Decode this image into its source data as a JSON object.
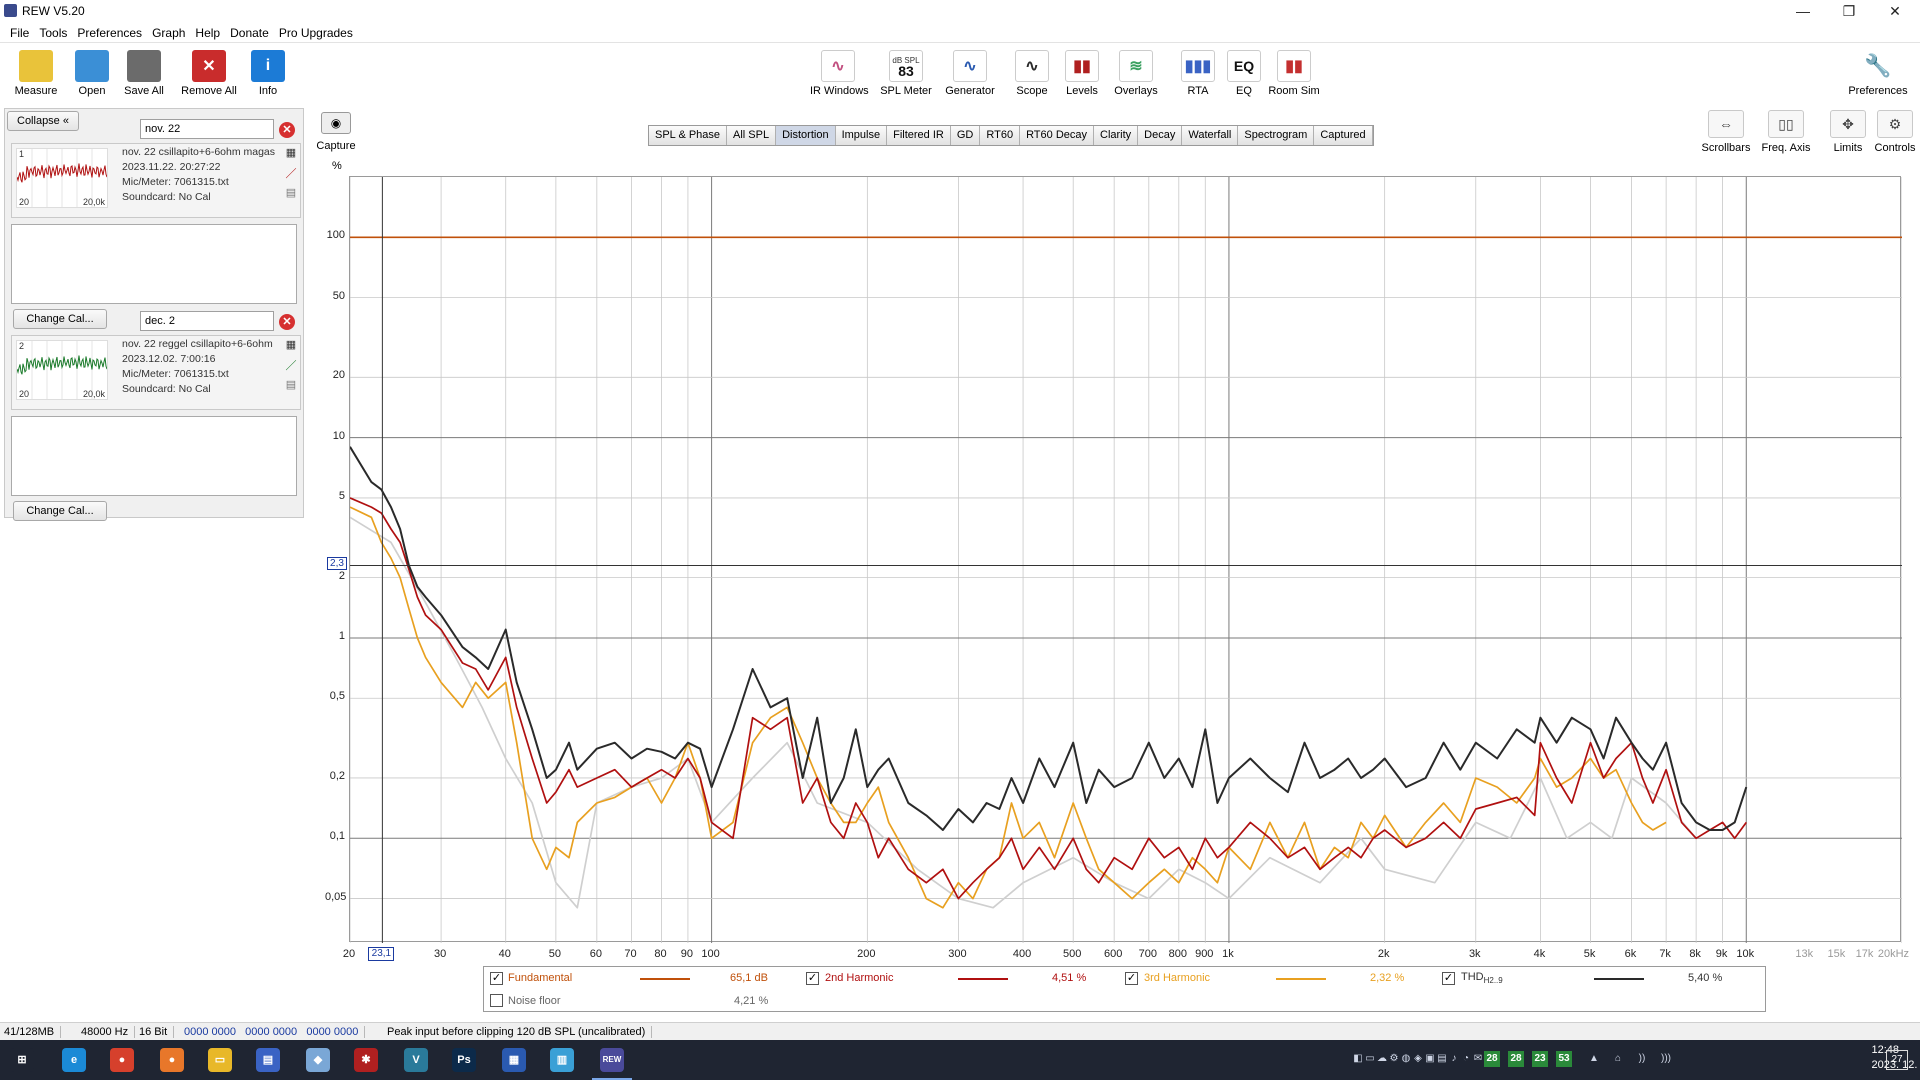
{
  "window": {
    "title": "REW V5.20",
    "minimize": "—",
    "maximize": "❐",
    "close": "✕"
  },
  "menu": [
    "File",
    "Tools",
    "Preferences",
    "Graph",
    "Help",
    "Donate",
    "Pro Upgrades"
  ],
  "toolbar_left": [
    {
      "label": "Measure",
      "icon": "measure-icon",
      "color": "#e9c33a"
    },
    {
      "label": "Open",
      "icon": "folder-open-icon",
      "color": "#3b8fd6"
    },
    {
      "label": "Save All",
      "icon": "save-icon",
      "color": "#6b6b6b"
    },
    {
      "label": "Remove All",
      "icon": "remove-icon",
      "color": "#c92c2c"
    },
    {
      "label": "Info",
      "icon": "info-icon",
      "color": "#1c7bd6"
    }
  ],
  "toolbar_center": [
    {
      "label": "IR Windows",
      "icon": "ir-windows-icon"
    },
    {
      "label": "SPL Meter",
      "icon": "spl-meter-icon",
      "badge_top": "dB SPL",
      "badge_value": "83"
    },
    {
      "label": "Generator",
      "icon": "generator-icon"
    },
    {
      "label": "Scope",
      "icon": "scope-icon"
    },
    {
      "label": "Levels",
      "icon": "levels-icon"
    },
    {
      "label": "Overlays",
      "icon": "overlays-icon"
    },
    {
      "label": "RTA",
      "icon": "rta-icon"
    },
    {
      "label": "EQ",
      "icon": "eq-icon",
      "badge_value": "EQ"
    },
    {
      "label": "Room Sim",
      "icon": "room-sim-icon"
    }
  ],
  "toolbar_right": {
    "label": "Preferences",
    "icon": "wrench-icon"
  },
  "left_panel": {
    "collapse_label": "Collapse",
    "measurements": [
      {
        "index": "1",
        "name_field": "nov. 22",
        "title": "nov. 22 csillapito+6-6ohm magas",
        "date": "2023.11.22. 20:27:22",
        "mic": "Mic/Meter: 7061315.txt",
        "soundcard": "Soundcard: No Cal",
        "thumb_min": "20",
        "thumb_max": "20,0k",
        "color": "#b01010",
        "change_cal": "Change Cal..."
      },
      {
        "index": "2",
        "name_field": "dec. 2",
        "title": "nov. 22 reggel csillapito+6-6ohm",
        "date": "2023.12.02. 7:00:16",
        "mic": "Mic/Meter: 7061315.txt",
        "soundcard": "Soundcard: No Cal",
        "thumb_min": "20",
        "thumb_max": "20,0k",
        "color": "#1a7a2a",
        "change_cal": "Change Cal..."
      }
    ]
  },
  "capture": {
    "label": "Capture",
    "icon": "camera-icon"
  },
  "tabs": [
    "SPL & Phase",
    "All SPL",
    "Distortion",
    "Impulse",
    "Filtered IR",
    "GD",
    "RT60",
    "RT60 Decay",
    "Clarity",
    "Decay",
    "Waterfall",
    "Spectrogram",
    "Captured"
  ],
  "active_tab": "Distortion",
  "right_tools": [
    {
      "label": "Scrollbars",
      "icon": "scrollbars-icon"
    },
    {
      "label": "Freq. Axis",
      "icon": "freq-axis-icon"
    },
    {
      "label": "Limits",
      "icon": "limits-icon"
    },
    {
      "label": "Controls",
      "icon": "gear-icon"
    }
  ],
  "graph": {
    "y_unit": "%",
    "cursor_y_label": "2,3",
    "cursor_x_label": "23,1",
    "y_tick_labels": [
      "100",
      "50",
      "20",
      "10",
      "5",
      "2",
      "1",
      "0,5",
      "0,2",
      "0,1",
      "0,05"
    ],
    "x_tick_labels": [
      "20",
      "30",
      "40",
      "50",
      "60",
      "70",
      "80",
      "90",
      "100",
      "200",
      "300",
      "400",
      "500",
      "600",
      "700",
      "800",
      "900",
      "1k",
      "2k",
      "3k",
      "4k",
      "5k",
      "6k",
      "7k",
      "8k",
      "9k",
      "10k"
    ],
    "x_tick_labels_faded": [
      "13k",
      "15k",
      "17k",
      "20kHz"
    ],
    "colors": {
      "fundamental": "#c0500a",
      "h2": "#b01010",
      "h3": "#e8a020",
      "thd": "#2a2a2a",
      "noise": "#cfcfcf"
    }
  },
  "chart_data": {
    "type": "line",
    "title": "",
    "xlabel": "",
    "ylabel": "%",
    "x_scale": "log",
    "y_scale": "log",
    "xlim": [
      20,
      20000
    ],
    "ylim": [
      0.03,
      200
    ],
    "grid": true,
    "legend_placement": "bottom",
    "cursor": {
      "x": 23.1,
      "y": 2.3
    },
    "series": [
      {
        "name": "Fundamental",
        "key": "fundamental",
        "x": [
          20,
          20000
        ],
        "y": [
          100,
          100
        ]
      },
      {
        "name": "THD",
        "key": "thd",
        "x": [
          20,
          22,
          23,
          24,
          25,
          26,
          27,
          28,
          30,
          33,
          35,
          37,
          40,
          42,
          45,
          48,
          50,
          53,
          55,
          60,
          65,
          70,
          75,
          80,
          85,
          90,
          95,
          100,
          110,
          120,
          130,
          140,
          150,
          160,
          170,
          180,
          190,
          200,
          210,
          220,
          240,
          260,
          280,
          300,
          320,
          340,
          360,
          380,
          400,
          430,
          460,
          500,
          530,
          560,
          600,
          650,
          700,
          750,
          800,
          850,
          900,
          950,
          1000,
          1100,
          1200,
          1300,
          1400,
          1500,
          1600,
          1700,
          1800,
          1900,
          2000,
          2200,
          2400,
          2600,
          2800,
          3000,
          3300,
          3600,
          3900,
          4000,
          4300,
          4600,
          5000,
          5300,
          5600,
          6000,
          6300,
          6600,
          7000,
          7500,
          8000,
          8500,
          9000,
          9500,
          10000
        ],
        "y": [
          9,
          6,
          5.5,
          4.5,
          3.5,
          2.3,
          1.8,
          1.6,
          1.3,
          0.9,
          0.8,
          0.7,
          1.1,
          0.6,
          0.35,
          0.2,
          0.22,
          0.3,
          0.22,
          0.28,
          0.3,
          0.25,
          0.28,
          0.27,
          0.25,
          0.3,
          0.28,
          0.18,
          0.35,
          0.7,
          0.45,
          0.5,
          0.2,
          0.4,
          0.15,
          0.2,
          0.35,
          0.18,
          0.22,
          0.25,
          0.15,
          0.13,
          0.11,
          0.14,
          0.12,
          0.15,
          0.14,
          0.2,
          0.15,
          0.25,
          0.18,
          0.3,
          0.15,
          0.22,
          0.18,
          0.2,
          0.3,
          0.2,
          0.25,
          0.18,
          0.35,
          0.15,
          0.2,
          0.25,
          0.2,
          0.17,
          0.3,
          0.2,
          0.22,
          0.25,
          0.2,
          0.22,
          0.25,
          0.18,
          0.2,
          0.3,
          0.22,
          0.3,
          0.25,
          0.35,
          0.3,
          0.4,
          0.3,
          0.4,
          0.35,
          0.25,
          0.4,
          0.3,
          0.25,
          0.22,
          0.3,
          0.15,
          0.12,
          0.11,
          0.11,
          0.12,
          0.18
        ]
      },
      {
        "name": "2nd Harmonic",
        "key": "h2",
        "x": [
          20,
          22,
          23,
          24,
          25,
          26,
          27,
          28,
          30,
          33,
          35,
          37,
          40,
          42,
          45,
          48,
          50,
          53,
          55,
          60,
          65,
          70,
          75,
          80,
          85,
          90,
          95,
          100,
          110,
          120,
          130,
          140,
          150,
          160,
          170,
          180,
          190,
          200,
          210,
          220,
          240,
          260,
          280,
          300,
          320,
          340,
          360,
          380,
          400,
          430,
          460,
          500,
          530,
          560,
          600,
          650,
          700,
          750,
          800,
          850,
          900,
          950,
          1000,
          1100,
          1200,
          1300,
          1400,
          1500,
          1600,
          1700,
          1800,
          1900,
          2000,
          2200,
          2400,
          2600,
          2800,
          3000,
          3300,
          3600,
          3900,
          4000,
          4300,
          4600,
          5000,
          5300,
          5600,
          6000,
          6300,
          6600,
          7000,
          7500,
          8000,
          8500,
          9000,
          9500,
          10000
        ],
        "y": [
          5,
          4.5,
          4.2,
          3.5,
          3,
          2.2,
          1.6,
          1.3,
          1.1,
          0.75,
          0.7,
          0.55,
          0.8,
          0.45,
          0.25,
          0.15,
          0.17,
          0.22,
          0.18,
          0.2,
          0.22,
          0.18,
          0.2,
          0.22,
          0.2,
          0.25,
          0.2,
          0.12,
          0.1,
          0.4,
          0.35,
          0.4,
          0.15,
          0.2,
          0.12,
          0.1,
          0.15,
          0.12,
          0.08,
          0.1,
          0.07,
          0.06,
          0.07,
          0.05,
          0.06,
          0.07,
          0.08,
          0.1,
          0.07,
          0.09,
          0.07,
          0.1,
          0.07,
          0.06,
          0.08,
          0.07,
          0.1,
          0.08,
          0.09,
          0.07,
          0.1,
          0.08,
          0.09,
          0.12,
          0.1,
          0.08,
          0.09,
          0.07,
          0.08,
          0.09,
          0.08,
          0.1,
          0.11,
          0.09,
          0.1,
          0.12,
          0.1,
          0.14,
          0.15,
          0.16,
          0.13,
          0.3,
          0.2,
          0.15,
          0.3,
          0.2,
          0.25,
          0.3,
          0.2,
          0.15,
          0.22,
          0.12,
          0.1,
          0.11,
          0.12,
          0.1,
          0.12
        ]
      },
      {
        "name": "3rd Harmonic",
        "key": "h3",
        "x": [
          20,
          22,
          23,
          24,
          25,
          26,
          27,
          28,
          30,
          33,
          35,
          37,
          40,
          42,
          45,
          48,
          50,
          53,
          55,
          60,
          65,
          70,
          75,
          80,
          85,
          90,
          95,
          100,
          110,
          120,
          130,
          140,
          150,
          160,
          170,
          180,
          190,
          200,
          210,
          220,
          240,
          260,
          280,
          300,
          320,
          340,
          360,
          380,
          400,
          430,
          460,
          500,
          530,
          560,
          600,
          650,
          700,
          750,
          800,
          850,
          900,
          950,
          1000,
          1100,
          1200,
          1300,
          1400,
          1500,
          1600,
          1700,
          1800,
          1900,
          2000,
          2200,
          2400,
          2600,
          2800,
          3000,
          3300,
          3600,
          3900,
          4000,
          4300,
          4600,
          5000,
          5300,
          5600,
          6000,
          6300,
          6600,
          7000
        ],
        "y": [
          4.5,
          4,
          3,
          2.5,
          2,
          1.4,
          1,
          0.8,
          0.6,
          0.45,
          0.6,
          0.5,
          0.6,
          0.3,
          0.1,
          0.07,
          0.09,
          0.08,
          0.12,
          0.15,
          0.16,
          0.18,
          0.2,
          0.15,
          0.2,
          0.3,
          0.2,
          0.1,
          0.12,
          0.3,
          0.4,
          0.45,
          0.3,
          0.2,
          0.15,
          0.12,
          0.12,
          0.15,
          0.18,
          0.12,
          0.08,
          0.05,
          0.045,
          0.06,
          0.05,
          0.07,
          0.08,
          0.15,
          0.1,
          0.12,
          0.08,
          0.15,
          0.1,
          0.07,
          0.06,
          0.05,
          0.06,
          0.07,
          0.06,
          0.08,
          0.07,
          0.06,
          0.09,
          0.07,
          0.12,
          0.08,
          0.12,
          0.07,
          0.09,
          0.08,
          0.12,
          0.1,
          0.13,
          0.09,
          0.12,
          0.15,
          0.12,
          0.2,
          0.18,
          0.15,
          0.2,
          0.25,
          0.18,
          0.2,
          0.25,
          0.2,
          0.22,
          0.15,
          0.12,
          0.11,
          0.12
        ]
      },
      {
        "name": "Noise floor",
        "key": "noise",
        "x": [
          20,
          24,
          28,
          32,
          36,
          40,
          45,
          50,
          55,
          60,
          70,
          80,
          90,
          100,
          120,
          140,
          160,
          200,
          250,
          300,
          350,
          400,
          500,
          600,
          700,
          800,
          900,
          1000,
          1200,
          1500,
          1800,
          2000,
          2500,
          3000,
          3500,
          4000,
          4500,
          5000,
          5500,
          6000,
          7000,
          8000
        ],
        "y": [
          4,
          3,
          1.5,
          0.8,
          0.45,
          0.25,
          0.15,
          0.06,
          0.045,
          0.15,
          0.18,
          0.2,
          0.25,
          0.12,
          0.2,
          0.3,
          0.15,
          0.12,
          0.07,
          0.05,
          0.045,
          0.06,
          0.08,
          0.06,
          0.05,
          0.07,
          0.06,
          0.05,
          0.08,
          0.06,
          0.1,
          0.07,
          0.06,
          0.12,
          0.1,
          0.2,
          0.1,
          0.12,
          0.1,
          0.2,
          0.15,
          0.1
        ]
      }
    ]
  },
  "legend": {
    "fundamental": {
      "label": "Fundamental",
      "value": "65,1 dB",
      "checked": "✓"
    },
    "h2": {
      "label": "2nd Harmonic",
      "value": "4,51 %",
      "checked": "✓"
    },
    "h3": {
      "label": "3rd Harmonic",
      "value": "2,32 %",
      "checked": "✓"
    },
    "thd": {
      "label": "THD",
      "sub": "H2..9",
      "value": "5,40 %",
      "checked": "✓"
    },
    "noise": {
      "label": "Noise floor",
      "value": "4,21 %",
      "checked": ""
    }
  },
  "status": {
    "memory": "41/128MB",
    "rate": "48000 Hz",
    "bits": "16 Bit",
    "hex": "0000 0000   0000 0000   0000 0000",
    "message": "Peak input before clipping 120 dB SPL (uncalibrated)"
  },
  "taskbar": {
    "apps": [
      {
        "name": "start-icon",
        "text": "⊞",
        "color": "#1f2532"
      },
      {
        "name": "edge-icon",
        "text": "e",
        "color": "#1b8ad6"
      },
      {
        "name": "chrome-icon",
        "text": "●",
        "color": "#d6402c"
      },
      {
        "name": "firefox-icon",
        "text": "●",
        "color": "#e8772a"
      },
      {
        "name": "explorer-icon",
        "text": "▭",
        "color": "#e8b829"
      },
      {
        "name": "save-app-icon",
        "text": "▤",
        "color": "#3a63c4"
      },
      {
        "name": "notepad-icon",
        "text": "◆",
        "color": "#7aa7d6"
      },
      {
        "name": "app-red-icon",
        "text": "✱",
        "color": "#b02020"
      },
      {
        "name": "v-app-icon",
        "text": "V",
        "color": "#2a7a9a"
      },
      {
        "name": "photoshop-icon",
        "text": "Ps",
        "color": "#0c2a4a"
      },
      {
        "name": "word-app-icon",
        "text": "▦",
        "color": "#2a5ab0"
      },
      {
        "name": "doc-app-icon",
        "text": "▥",
        "color": "#3aa0d6"
      },
      {
        "name": "rew-app-icon",
        "text": "REW",
        "color": "#4a4a9a"
      }
    ],
    "tray": [
      "28",
      "28",
      "23",
      "53"
    ],
    "time": "12:48",
    "date": "2023. 12. 06.",
    "notif": "27"
  }
}
